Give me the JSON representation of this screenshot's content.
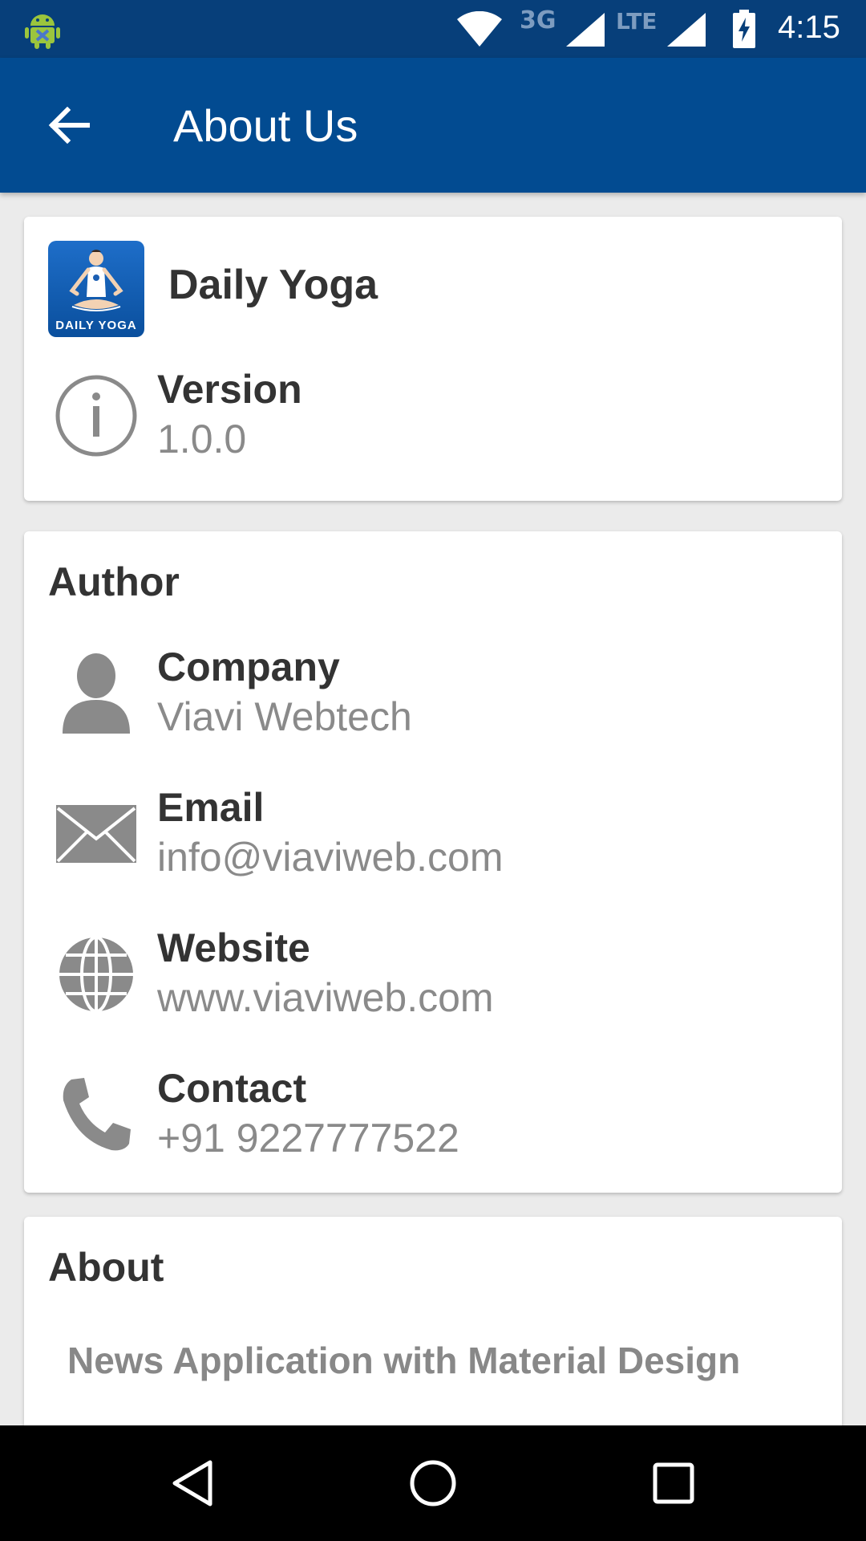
{
  "status_bar": {
    "network_3g": "3G",
    "network_lte": "LTE",
    "time": "4:15"
  },
  "app_bar": {
    "title": "About Us",
    "back_icon": "arrow-back-icon"
  },
  "app_info": {
    "logo_text": "DAILY YOGA",
    "app_name": "Daily Yoga",
    "version_label": "Version",
    "version_value": "1.0.0"
  },
  "author": {
    "title": "Author",
    "items": [
      {
        "icon": "person-icon",
        "label": "Company",
        "value": "Viavi Webtech"
      },
      {
        "icon": "envelope-icon",
        "label": "Email",
        "value": "info@viaviweb.com"
      },
      {
        "icon": "globe-icon",
        "label": "Website",
        "value": "www.viaviweb.com"
      },
      {
        "icon": "phone-icon",
        "label": "Contact",
        "value": "+91 9227777522"
      }
    ]
  },
  "about": {
    "title": "About",
    "text": "News Application with Material Design"
  },
  "colors": {
    "status_bar": "#073f7a",
    "app_bar": "#024b91",
    "background": "#ebebeb",
    "label": "#333333",
    "value": "#8a8a8a"
  }
}
